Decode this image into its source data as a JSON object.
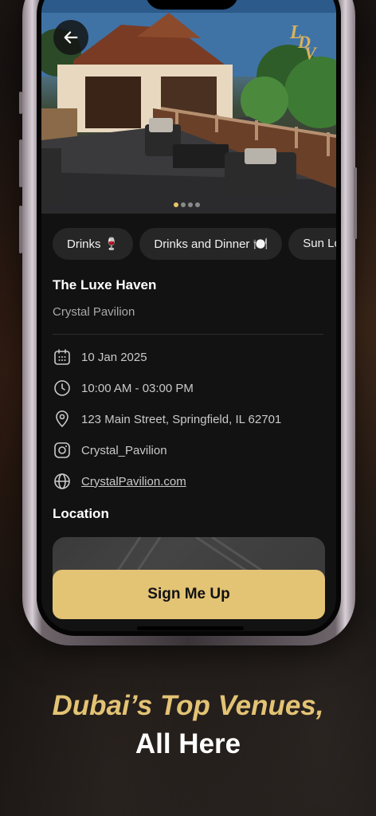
{
  "colors": {
    "accent": "#e3c374",
    "background": "#121212",
    "chip": "#262626"
  },
  "hero": {
    "back_icon": "arrow-left-icon",
    "logo_text": "LDV",
    "carousel": {
      "count": 4,
      "active_index": 0
    }
  },
  "chips": [
    "Drinks 🍷",
    "Drinks and Dinner 🍽️",
    "Sun Lo"
  ],
  "venue": {
    "name": "The Luxe Haven",
    "subtitle": "Crystal Pavilion"
  },
  "details": {
    "date": "10 Jan 2025",
    "time": "10:00 AM - 03:00 PM",
    "address": "123 Main Street, Springfield, IL 62701",
    "instagram": "Crystal_Pavilion",
    "website": "CrystalPavilion.com"
  },
  "location": {
    "title": "Location"
  },
  "cta": {
    "label": "Sign Me Up"
  },
  "tagline": {
    "line1": "Dubai’s Top Venues,",
    "line2": "All Here"
  }
}
